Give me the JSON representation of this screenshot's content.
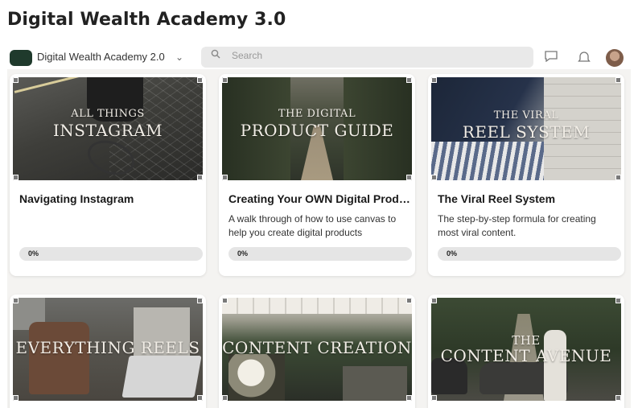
{
  "page": {
    "title": "Digital Wealth Academy 3.0"
  },
  "header": {
    "app_name": "Digital Wealth Academy 2.0",
    "search_placeholder": "Search"
  },
  "courses": [
    {
      "thumb_small": "All things",
      "thumb_big": "Instagram",
      "title": "Navigating Instagram",
      "description": "",
      "progress_label": "0%",
      "progress": 0
    },
    {
      "thumb_small": "The Digital",
      "thumb_big": "Product Guide",
      "title": "Creating Your OWN Digital Produc...",
      "description": "A walk through of how to use canvas to help you create digital products",
      "progress_label": "0%",
      "progress": 0
    },
    {
      "thumb_small": "The Viral",
      "thumb_big": "Reel System",
      "title": "The Viral Reel System",
      "description": "The step-by-step formula for creating most viral content.",
      "progress_label": "0%",
      "progress": 0
    },
    {
      "thumb_small": "",
      "thumb_big": "Everything Reels",
      "title": "",
      "description": "",
      "progress_label": "",
      "progress": 0
    },
    {
      "thumb_small": "",
      "thumb_big": "Content Creation",
      "title": "",
      "description": "",
      "progress_label": "",
      "progress": 0
    },
    {
      "thumb_small": "The",
      "thumb_big": "Content Avenue",
      "title": "",
      "description": "",
      "progress_label": "",
      "progress": 0
    }
  ],
  "colors": {
    "brand": "#1f3a2c",
    "progress_track": "#e5e5e5",
    "content_bg": "#f4f3f1"
  }
}
